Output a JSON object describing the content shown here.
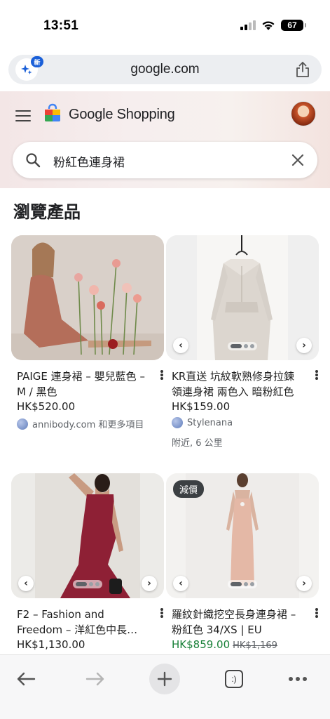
{
  "status_bar": {
    "time": "13:51",
    "battery": "67"
  },
  "browser": {
    "url": "google.com",
    "ai_badge": "新"
  },
  "header": {
    "title": "Google Shopping"
  },
  "search": {
    "query": "粉紅色連身裙"
  },
  "section": {
    "title": "瀏覽產品"
  },
  "products": [
    {
      "title": "PAIGE 連身裙 – 嬰兒藍色 – M / 黑色",
      "price": "HK$520.00",
      "seller": "annibody.com 和更多項目"
    },
    {
      "title": "KR直送 坑紋軟熟修身拉鍊領連身裙 兩色入 暗粉紅色",
      "price": "HK$159.00",
      "seller": "Stylenana",
      "distance": "附近, 6 公里"
    },
    {
      "title": "F2 – Fashion and Freedom – 洋紅色中長…",
      "price": "HK$1,130.00"
    },
    {
      "title": "羅紋針織挖空長身連身裙 – 粉紅色 34/XS | EU",
      "price": "HK$859.00",
      "old_price": "HK$1,169",
      "badge": "減價"
    }
  ],
  "toolbar": {
    "tab_label": ":)"
  },
  "colors": {
    "sale_price": "#188038",
    "accent": "#1a5fd8"
  }
}
